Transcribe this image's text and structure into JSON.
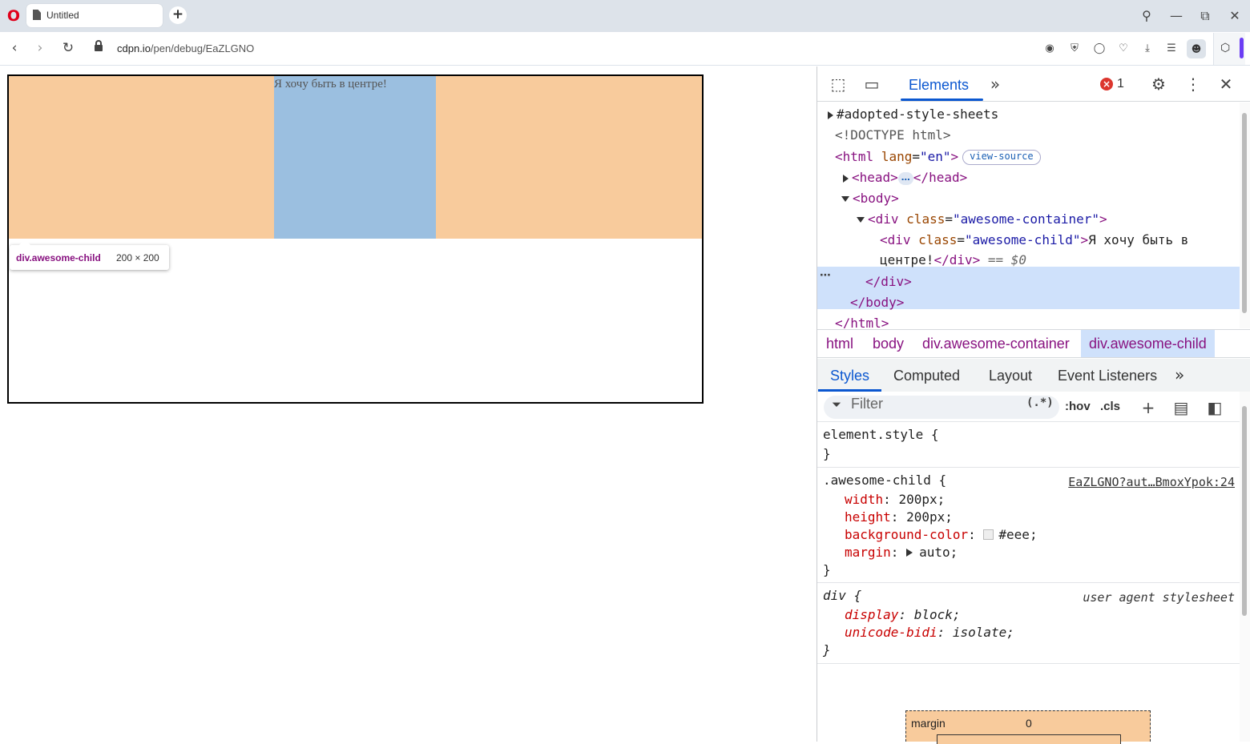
{
  "browser": {
    "tab_title": "Untitled",
    "url_host": "cdpn.io",
    "url_path": "/pen/debug/EaZLGNO"
  },
  "page": {
    "child_text": "Я хочу быть в центре!",
    "overlay_color": "#f8cb9c",
    "content_color": "#9bbfe0"
  },
  "tooltip": {
    "tag": "div.awesome-child",
    "size": "200 × 200"
  },
  "devtools": {
    "main_tab": "Elements",
    "error_count": "1",
    "dom": {
      "adopted": "#adopted-style-sheets",
      "doctype": "<!DOCTYPE html>",
      "html_open_tag": "<html",
      "html_attr_name": "lang",
      "html_attr_value": "\"en\"",
      "html_close_bracket": ">",
      "view_source": "view-source",
      "head_open": "<head>",
      "head_ellipsis": "…",
      "head_close": "</head>",
      "body_open": "<body>",
      "div_open_tag": "<div",
      "class_attr": "class",
      "container_class_value": "\"awesome-container\"",
      "child_class_value": "\"awesome-child\"",
      "tag_end": ">",
      "child_text_line1": "Я хочу быть в",
      "child_text_line2": "центре!",
      "div_close": "</div>",
      "eq_dollar0": "== $0",
      "body_close": "</body>",
      "html_close": "</html>"
    },
    "breadcrumbs": [
      "html",
      "body",
      "div.awesome-container",
      "div.awesome-child"
    ],
    "subtabs": [
      "Styles",
      "Computed",
      "Layout",
      "Event Listeners"
    ],
    "filter": {
      "placeholder": "Filter",
      "regex": "(.*)",
      "hov": ":hov",
      "cls": ".cls"
    },
    "styles": {
      "element_style": "element.style {",
      "close_brace": "}",
      "rule1_selector": ".awesome-child {",
      "rule1_source": "EaZLGNO?aut…BmoxYpok:24",
      "rule1_props": [
        {
          "name": "width",
          "value": "200px;"
        },
        {
          "name": "height",
          "value": "200px;"
        },
        {
          "name": "background-color",
          "value": "#eee;"
        },
        {
          "name": "margin",
          "value": "auto;"
        }
      ],
      "rule2_selector": "div {",
      "rule2_source": "user agent stylesheet",
      "rule2_props": [
        {
          "name": "display",
          "value": "block;"
        },
        {
          "name": "unicode-bidi",
          "value": "isolate;"
        }
      ],
      "colon": ":"
    },
    "box_model": {
      "label": "margin",
      "value": "0"
    }
  }
}
